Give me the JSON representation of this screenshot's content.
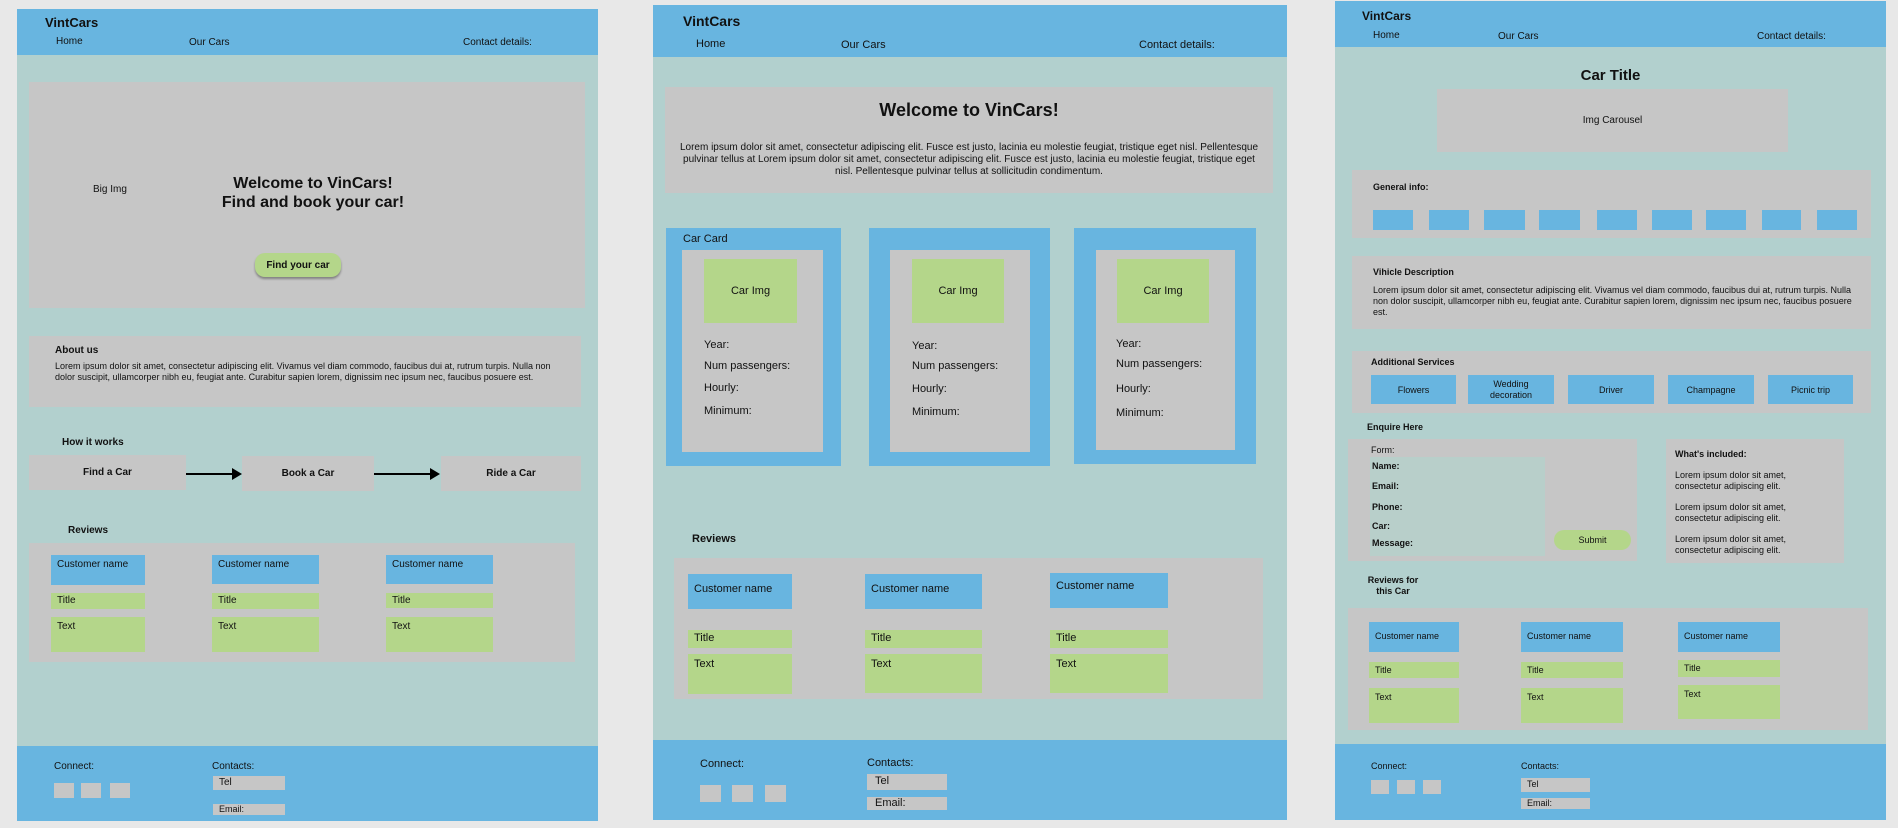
{
  "brand": "VintCars",
  "nav": {
    "home": "Home",
    "cars": "Our Cars",
    "contact": "Contact details:"
  },
  "footer": {
    "connect": "Connect:",
    "contacts": "Contacts:",
    "tel": "Tel",
    "email": "Email:"
  },
  "review": {
    "name": "Customer name",
    "title": "Title",
    "text": "Text"
  },
  "lorem_about": "Lorem ipsum dolor sit amet, consectetur adipiscing elit. Vivamus vel diam commodo, faucibus dui at, rutrum turpis. Nulla non dolor suscipit, ullamcorper nibh eu, feugiat ante. Curabitur sapien lorem, dignissim nec ipsum nec, faucibus posuere est.",
  "page1": {
    "hero_img": "Big Img",
    "hero_title1": "Welcome to VinCars!",
    "hero_title2": "Find and book your car!",
    "hero_button": "Find your car",
    "about_title": "About us",
    "how_title": "How it works",
    "steps": [
      "Find a Car",
      "Book a Car",
      "Ride a Car"
    ],
    "reviews_title": "Reviews"
  },
  "page2": {
    "welcome": "Welcome to VinCars!",
    "intro": "Lorem ipsum dolor sit amet, consectetur adipiscing elit. Fusce est justo, lacinia eu molestie feugiat, tristique eget nisl. Pellentesque pulvinar tellus at Lorem ipsum dolor sit amet, consectetur adipiscing elit. Fusce est justo, lacinia eu molestie feugiat, tristique eget nisl. Pellentesque pulvinar tellus at sollicitudin condimentum.",
    "card_label": "Car Card",
    "car_img": "Car Img",
    "fields": [
      "Year:",
      "Num passengers:",
      "Hourly:",
      "Minimum:"
    ],
    "reviews_title": "Reviews"
  },
  "page3": {
    "title": "Car Title",
    "carousel": "Img Carousel",
    "general": "General info:",
    "desc_title": "Vihicle Description",
    "services_title": "Additional Services",
    "services": [
      "Flowers",
      "Wedding decoration",
      "Driver",
      "Champagne",
      "Picnic trip"
    ],
    "enquire": "Enquire Here",
    "form": "Form:",
    "form_fields": [
      "Name:",
      "Email:",
      "Phone:",
      "Car:",
      "Message:"
    ],
    "submit": "Submit",
    "included_title": "What's included:",
    "included_item": "Lorem ipsum dolor sit amet, consectetur adipiscing elit.",
    "reviews_for": "Reviews for this Car"
  }
}
